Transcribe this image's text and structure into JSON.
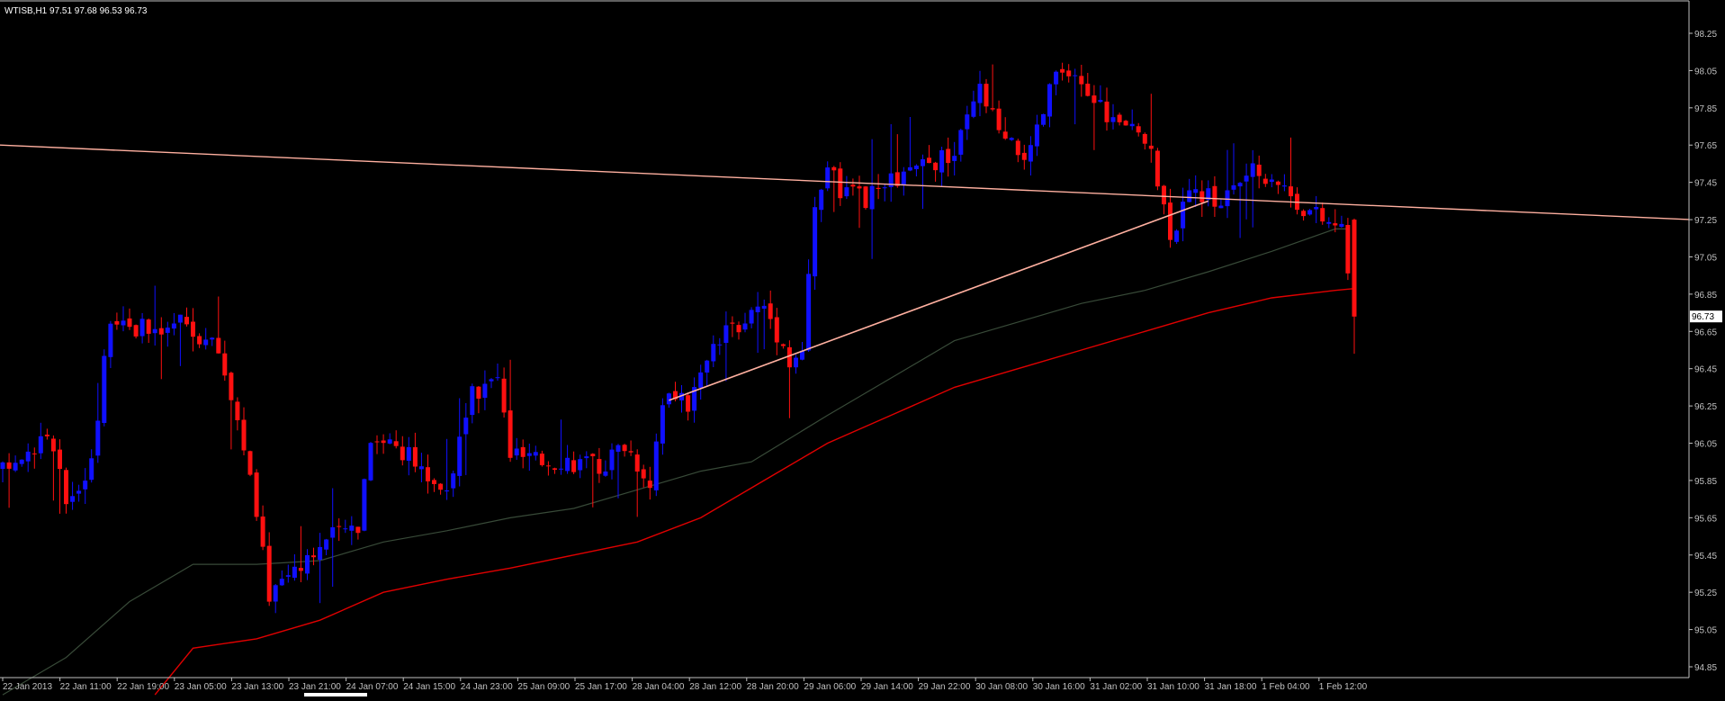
{
  "header": {
    "symbol_line": "WTISB,H1  97.51 97.68 96.53 96.73"
  },
  "colors": {
    "background": "#000000",
    "axis": "#c0c0c0",
    "bull": "#1010ff",
    "bear": "#ff1010",
    "ma_fast": "#384a38",
    "ma_slow": "#e00000",
    "trend_line": "#ffb0a0",
    "price_label_bg": "#ffffff",
    "price_label_text": "#000000"
  },
  "chart_data": {
    "type": "candlestick",
    "symbol": "WTISB",
    "timeframe": "H1",
    "ylim": [
      94.75,
      98.35
    ],
    "grid": false,
    "current_price": "96.73",
    "yticks": [
      "98.25",
      "98.05",
      "97.85",
      "97.65",
      "97.45",
      "97.25",
      "97.05",
      "96.85",
      "96.65",
      "96.45",
      "96.25",
      "96.05",
      "95.85",
      "95.65",
      "95.45",
      "95.25",
      "95.05",
      "94.85"
    ],
    "xticks": [
      "22 Jan 2013",
      "22 Jan 11:00",
      "22 Jan 19:00",
      "23 Jan 05:00",
      "23 Jan 13:00",
      "23 Jan 21:00",
      "24 Jan 07:00",
      "24 Jan 15:00",
      "24 Jan 23:00",
      "25 Jan 09:00",
      "25 Jan 17:00",
      "28 Jan 04:00",
      "28 Jan 12:00",
      "28 Jan 20:00",
      "29 Jan 06:00",
      "29 Jan 14:00",
      "29 Jan 22:00",
      "30 Jan 08:00",
      "30 Jan 16:00",
      "31 Jan 02:00",
      "31 Jan 10:00",
      "31 Jan 18:00",
      "1 Feb 04:00",
      "1 Feb 12:00"
    ],
    "close_path": [
      [
        0,
        95.9
      ],
      [
        7,
        96.1
      ],
      [
        10,
        95.75
      ],
      [
        14,
        95.95
      ],
      [
        17,
        96.75
      ],
      [
        20,
        96.7
      ],
      [
        24,
        96.62
      ],
      [
        28,
        96.7
      ],
      [
        34,
        96.55
      ],
      [
        38,
        96.05
      ],
      [
        42,
        95.25
      ],
      [
        46,
        95.4
      ],
      [
        52,
        95.55
      ],
      [
        56,
        95.62
      ],
      [
        58,
        96.1
      ],
      [
        62,
        96.05
      ],
      [
        66,
        95.9
      ],
      [
        70,
        95.8
      ],
      [
        74,
        96.3
      ],
      [
        78,
        96.4
      ],
      [
        80,
        96.0
      ],
      [
        84,
        95.95
      ],
      [
        88,
        95.97
      ],
      [
        94,
        95.92
      ],
      [
        98,
        96.05
      ],
      [
        102,
        95.85
      ],
      [
        104,
        96.3
      ],
      [
        108,
        96.25
      ],
      [
        112,
        96.55
      ],
      [
        116,
        96.7
      ],
      [
        120,
        96.8
      ],
      [
        122,
        96.65
      ],
      [
        124,
        96.5
      ],
      [
        126,
        96.55
      ],
      [
        128,
        97.3
      ],
      [
        130,
        97.55
      ],
      [
        132,
        97.4
      ],
      [
        136,
        97.35
      ],
      [
        140,
        97.45
      ],
      [
        146,
        97.55
      ],
      [
        150,
        97.6
      ],
      [
        154,
        97.95
      ],
      [
        158,
        97.65
      ],
      [
        162,
        97.6
      ],
      [
        166,
        98.05
      ],
      [
        168,
        98.0
      ],
      [
        172,
        97.9
      ],
      [
        176,
        97.75
      ],
      [
        180,
        97.7
      ],
      [
        184,
        97.2
      ],
      [
        188,
        97.4
      ],
      [
        192,
        97.35
      ],
      [
        196,
        97.5
      ],
      [
        200,
        97.5
      ],
      [
        204,
        97.35
      ],
      [
        208,
        97.25
      ],
      [
        211,
        97.2
      ],
      [
        213,
        96.73
      ]
    ],
    "series": [
      {
        "name": "",
        "style": "moving-average",
        "values": [
          [
            0,
            94.7
          ],
          [
            10,
            94.9
          ],
          [
            20,
            95.2
          ],
          [
            30,
            95.4
          ],
          [
            40,
            95.4
          ],
          [
            50,
            95.42
          ],
          [
            60,
            95.52
          ],
          [
            70,
            95.58
          ],
          [
            80,
            95.65
          ],
          [
            90,
            95.7
          ],
          [
            100,
            95.8
          ],
          [
            110,
            95.9
          ],
          [
            118,
            95.95
          ],
          [
            130,
            96.2
          ],
          [
            140,
            96.4
          ],
          [
            150,
            96.6
          ],
          [
            160,
            96.7
          ],
          [
            170,
            96.8
          ],
          [
            180,
            96.87
          ],
          [
            190,
            96.97
          ],
          [
            200,
            97.08
          ],
          [
            210,
            97.2
          ],
          [
            212,
            97.2
          ]
        ]
      },
      {
        "name": "",
        "style": "moving-average",
        "values": [
          [
            24,
            94.7
          ],
          [
            30,
            94.95
          ],
          [
            40,
            95.0
          ],
          [
            50,
            95.1
          ],
          [
            60,
            95.25
          ],
          [
            70,
            95.32
          ],
          [
            80,
            95.38
          ],
          [
            90,
            95.45
          ],
          [
            100,
            95.52
          ],
          [
            110,
            95.65
          ],
          [
            120,
            95.85
          ],
          [
            130,
            96.05
          ],
          [
            140,
            96.2
          ],
          [
            150,
            96.35
          ],
          [
            160,
            96.45
          ],
          [
            170,
            96.55
          ],
          [
            180,
            96.65
          ],
          [
            190,
            96.75
          ],
          [
            200,
            96.83
          ],
          [
            210,
            96.87
          ],
          [
            213,
            96.88
          ]
        ]
      }
    ],
    "trend_lines": [
      {
        "from": [
          0,
          97.65
        ],
        "to": [
          213,
          97.33
        ]
      },
      {
        "from": [
          105,
          96.28
        ],
        "to": [
          190,
          97.35
        ]
      }
    ]
  }
}
